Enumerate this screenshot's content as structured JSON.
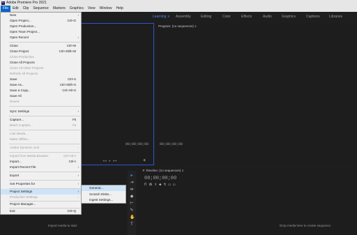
{
  "titlebar": {
    "icon_text": "Pr",
    "title": "Adobe Premiere Pro 2021"
  },
  "menubar": [
    "File",
    "Edit",
    "Clip",
    "Sequence",
    "Markers",
    "Graphics",
    "View",
    "Window",
    "Help"
  ],
  "workspaces": {
    "items": [
      "Learning",
      "Assembly",
      "Editing",
      "Color",
      "Effects",
      "Audio",
      "Graphics",
      "Captions",
      "Libraries"
    ],
    "active": "Learning",
    "menu_glyph": "≡"
  },
  "file_menu": {
    "items": [
      {
        "label": "New",
        "shortcut": "",
        "submenu": true,
        "disabled": false
      },
      {
        "label": "Open Project...",
        "shortcut": "Ctrl+O",
        "submenu": false,
        "disabled": false
      },
      {
        "label": "Open Production...",
        "shortcut": "",
        "submenu": false,
        "disabled": false
      },
      {
        "label": "Open Team Project...",
        "shortcut": "",
        "submenu": false,
        "disabled": false
      },
      {
        "label": "Open Recent",
        "shortcut": "",
        "submenu": true,
        "disabled": false
      },
      {
        "label": "Close",
        "shortcut": "Ctrl+W",
        "submenu": false,
        "disabled": false
      },
      {
        "label": "Close Project",
        "shortcut": "Ctrl+Shift+W",
        "submenu": false,
        "disabled": false
      },
      {
        "label": "Close Production",
        "shortcut": "",
        "submenu": false,
        "disabled": true
      },
      {
        "label": "Close All Projects",
        "shortcut": "",
        "submenu": false,
        "disabled": false
      },
      {
        "label": "Close All Other Projects",
        "shortcut": "",
        "submenu": false,
        "disabled": true
      },
      {
        "label": "Refresh All Projects",
        "shortcut": "",
        "submenu": false,
        "disabled": true
      },
      {
        "label": "Save",
        "shortcut": "Ctrl+S",
        "submenu": false,
        "disabled": false
      },
      {
        "label": "Save As...",
        "shortcut": "Ctrl+Shift+S",
        "submenu": false,
        "disabled": false
      },
      {
        "label": "Save a Copy...",
        "shortcut": "Ctrl+Alt+S",
        "submenu": false,
        "disabled": false
      },
      {
        "label": "Save All",
        "shortcut": "",
        "submenu": false,
        "disabled": false
      },
      {
        "label": "Revert",
        "shortcut": "",
        "submenu": false,
        "disabled": true
      },
      {
        "label": "Sync Settings",
        "shortcut": "",
        "submenu": true,
        "disabled": false
      },
      {
        "label": "Capture...",
        "shortcut": "F5",
        "submenu": false,
        "disabled": false
      },
      {
        "label": "Batch Capture...",
        "shortcut": "F6",
        "submenu": false,
        "disabled": true
      },
      {
        "label": "Link Media...",
        "shortcut": "",
        "submenu": false,
        "disabled": true
      },
      {
        "label": "Make Offline...",
        "shortcut": "",
        "submenu": false,
        "disabled": true
      },
      {
        "label": "Adobe Dynamic Link",
        "shortcut": "",
        "submenu": true,
        "disabled": true
      },
      {
        "label": "Import from Media Browser",
        "shortcut": "Ctrl+Alt+I",
        "submenu": false,
        "disabled": true
      },
      {
        "label": "Import...",
        "shortcut": "Ctrl+I",
        "submenu": false,
        "disabled": false
      },
      {
        "label": "Import Recent File",
        "shortcut": "",
        "submenu": true,
        "disabled": false
      },
      {
        "label": "Export",
        "shortcut": "",
        "submenu": true,
        "disabled": false
      },
      {
        "label": "Get Properties for",
        "shortcut": "",
        "submenu": true,
        "disabled": false
      },
      {
        "label": "Project Settings",
        "shortcut": "",
        "submenu": true,
        "disabled": false,
        "highlighted": true
      },
      {
        "label": "Production Settings",
        "shortcut": "",
        "submenu": true,
        "disabled": true
      },
      {
        "label": "Project Manager...",
        "shortcut": "",
        "submenu": false,
        "disabled": false
      },
      {
        "label": "Exit",
        "shortcut": "Ctrl+Q",
        "submenu": false,
        "disabled": false
      }
    ]
  },
  "project_settings_submenu": [
    "General...",
    "Scratch Disks...",
    "Ingest Settings..."
  ],
  "program_monitor": {
    "title": "Program: (no sequences)",
    "menu_glyph": "≡",
    "timecode": "00;00;00;00"
  },
  "source_monitor": {
    "timecode": "00;00;00;00"
  },
  "timeline": {
    "title": "Timeline: (no sequences)",
    "menu_glyph": "≡",
    "timecode": "00;00;00;00"
  },
  "project_panel": {
    "hint": "Import media to start"
  },
  "timeline_hint": "Drop media here to create sequence.",
  "colors": {
    "accent": "#0a64c8",
    "frame_border": "#2f55d4",
    "workspace_active": "#4d8de6"
  }
}
